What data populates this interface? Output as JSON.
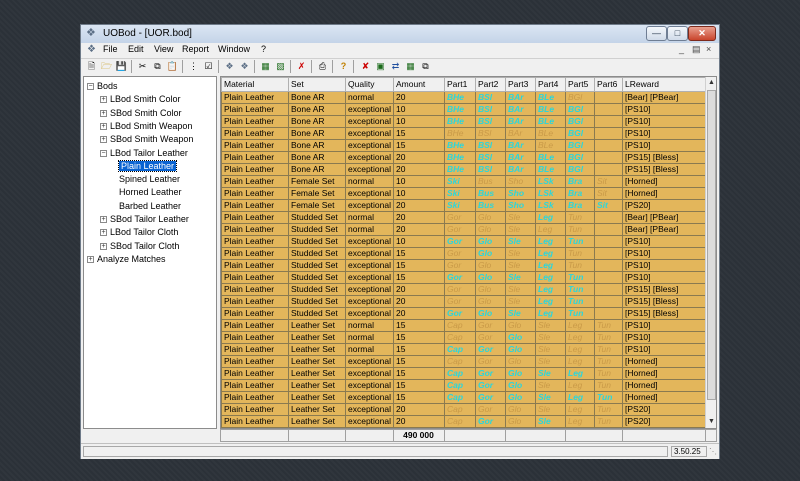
{
  "window": {
    "title": "UOBod - [UOR.bod]"
  },
  "menu": [
    "File",
    "Edit",
    "View",
    "Report",
    "Window",
    "?"
  ],
  "mdi": {
    "min": "_",
    "restore": "&#9635;",
    "close": "×"
  },
  "tree": [
    {
      "label": "Bods",
      "box": "−",
      "indent": 0
    },
    {
      "label": "LBod Smith Color",
      "box": "+",
      "indent": 1
    },
    {
      "label": "SBod Smith Color",
      "box": "+",
      "indent": 1
    },
    {
      "label": "LBod Smith Weapon",
      "box": "+",
      "indent": 1
    },
    {
      "label": "SBod Smith Weapon",
      "box": "+",
      "indent": 1
    },
    {
      "label": "LBod Tailor Leather",
      "box": "−",
      "indent": 1
    },
    {
      "label": "Plain Leather",
      "box": "",
      "indent": 2,
      "selected": true
    },
    {
      "label": "Spined Leather",
      "box": "",
      "indent": 2
    },
    {
      "label": "Horned Leather",
      "box": "",
      "indent": 2
    },
    {
      "label": "Barbed Leather",
      "box": "",
      "indent": 2
    },
    {
      "label": "SBod Tailor Leather",
      "box": "+",
      "indent": 1
    },
    {
      "label": "LBod Tailor Cloth",
      "box": "+",
      "indent": 1
    },
    {
      "label": "SBod Tailor Cloth",
      "box": "+",
      "indent": 1
    },
    {
      "label": "Analyze Matches",
      "box": "+",
      "indent": 0
    }
  ],
  "grid": {
    "columns": [
      "Material",
      "Set",
      "Quality",
      "Amount",
      "Part1",
      "Part2",
      "Part3",
      "Part4",
      "Part5",
      "Part6",
      "LReward"
    ],
    "rows": [
      [
        "Plain Leather",
        "Bone AR",
        "normal",
        "20",
        "BHe",
        "BSl",
        "BAr",
        "BLe",
        "BGl",
        "",
        "[Bear] [PBear]"
      ],
      [
        "Plain Leather",
        "Bone AR",
        "exceptional",
        "10",
        "BHe",
        "BSl",
        "BAr",
        "BLe",
        "BGl",
        "",
        "[PS10]"
      ],
      [
        "Plain Leather",
        "Bone AR",
        "exceptional",
        "10",
        "BHe",
        "BSl",
        "BAr",
        "BLe",
        "BGl",
        "",
        "[PS10]"
      ],
      [
        "Plain Leather",
        "Bone AR",
        "exceptional",
        "15",
        "BHe",
        "BSl",
        "BAr",
        "BLe",
        "BGl",
        "",
        "[PS10]"
      ],
      [
        "Plain Leather",
        "Bone AR",
        "exceptional",
        "15",
        "BHe",
        "BSl",
        "BAr",
        "BLe",
        "BGl",
        "",
        "[PS10]"
      ],
      [
        "Plain Leather",
        "Bone AR",
        "exceptional",
        "20",
        "BHe",
        "BSl",
        "BAr",
        "BLe",
        "BGl",
        "",
        "[PS15] [Bless]"
      ],
      [
        "Plain Leather",
        "Bone AR",
        "exceptional",
        "20",
        "BHe",
        "BSl",
        "BAr",
        "BLe",
        "BGl",
        "",
        "[PS15] [Bless]"
      ],
      [
        "Plain Leather",
        "Female Set",
        "normal",
        "10",
        "Ski",
        "Bus",
        "Sho",
        "LSk",
        "Bra",
        "Sit",
        "[Horned]"
      ],
      [
        "Plain Leather",
        "Female Set",
        "exceptional",
        "10",
        "Ski",
        "Bus",
        "Sho",
        "LSk",
        "Bra",
        "Sit",
        "[Horned]"
      ],
      [
        "Plain Leather",
        "Female Set",
        "exceptional",
        "20",
        "Ski",
        "Bus",
        "Sho",
        "LSk",
        "Bra",
        "Sit",
        "[PS20]"
      ],
      [
        "Plain Leather",
        "Studded Set",
        "normal",
        "20",
        "Gor",
        "Glo",
        "Sle",
        "Leg",
        "Tun",
        "",
        "[Bear] [PBear]"
      ],
      [
        "Plain Leather",
        "Studded Set",
        "normal",
        "20",
        "Gor",
        "Glo",
        "Sle",
        "Leg",
        "Tun",
        "",
        "[Bear] [PBear]"
      ],
      [
        "Plain Leather",
        "Studded Set",
        "exceptional",
        "10",
        "Gor",
        "Glo",
        "Sle",
        "Leg",
        "Tun",
        "",
        "[PS10]"
      ],
      [
        "Plain Leather",
        "Studded Set",
        "exceptional",
        "15",
        "Gor",
        "Glo",
        "Sle",
        "Leg",
        "Tun",
        "",
        "[PS10]"
      ],
      [
        "Plain Leather",
        "Studded Set",
        "exceptional",
        "15",
        "Gor",
        "Glo",
        "Sle",
        "Leg",
        "Tun",
        "",
        "[PS10]"
      ],
      [
        "Plain Leather",
        "Studded Set",
        "exceptional",
        "15",
        "Gor",
        "Glo",
        "Sle",
        "Leg",
        "Tun",
        "",
        "[PS10]"
      ],
      [
        "Plain Leather",
        "Studded Set",
        "exceptional",
        "20",
        "Gor",
        "Glo",
        "Sle",
        "Leg",
        "Tun",
        "",
        "[PS15] [Bless]"
      ],
      [
        "Plain Leather",
        "Studded Set",
        "exceptional",
        "20",
        "Gor",
        "Glo",
        "Sle",
        "Leg",
        "Tun",
        "",
        "[PS15] [Bless]"
      ],
      [
        "Plain Leather",
        "Studded Set",
        "exceptional",
        "20",
        "Gor",
        "Glo",
        "Sle",
        "Leg",
        "Tun",
        "",
        "[PS15] [Bless]"
      ],
      [
        "Plain Leather",
        "Leather Set",
        "normal",
        "15",
        "Cap",
        "Gor",
        "Glo",
        "Sle",
        "Leg",
        "Tun",
        "[PS10]"
      ],
      [
        "Plain Leather",
        "Leather Set",
        "normal",
        "15",
        "Cap",
        "Gor",
        "Glo",
        "Sle",
        "Leg",
        "Tun",
        "[PS10]"
      ],
      [
        "Plain Leather",
        "Leather Set",
        "normal",
        "15",
        "Cap",
        "Gor",
        "Glo",
        "Sle",
        "Leg",
        "Tun",
        "[PS10]"
      ],
      [
        "Plain Leather",
        "Leather Set",
        "exceptional",
        "15",
        "Cap",
        "Gor",
        "Glo",
        "Sle",
        "Leg",
        "Tun",
        "[Horned]"
      ],
      [
        "Plain Leather",
        "Leather Set",
        "exceptional",
        "15",
        "Cap",
        "Gor",
        "Glo",
        "Sle",
        "Leg",
        "Tun",
        "[Horned]"
      ],
      [
        "Plain Leather",
        "Leather Set",
        "exceptional",
        "15",
        "Cap",
        "Gor",
        "Glo",
        "Sle",
        "Leg",
        "Tun",
        "[Horned]"
      ],
      [
        "Plain Leather",
        "Leather Set",
        "exceptional",
        "15",
        "Cap",
        "Gor",
        "Glo",
        "Sle",
        "Leg",
        "Tun",
        "[Horned]"
      ],
      [
        "Plain Leather",
        "Leather Set",
        "exceptional",
        "20",
        "Cap",
        "Gor",
        "Glo",
        "Sle",
        "Leg",
        "Tun",
        "[PS20]"
      ],
      [
        "Plain Leather",
        "Leather Set",
        "exceptional",
        "20",
        "Cap",
        "Gor",
        "Glo",
        "Sle",
        "Leg",
        "Tun",
        "[PS20]"
      ]
    ],
    "have": [
      [
        1,
        1,
        1,
        1,
        0,
        0
      ],
      [
        1,
        1,
        1,
        1,
        1,
        0
      ],
      [
        1,
        1,
        1,
        1,
        1,
        0
      ],
      [
        0,
        0,
        0,
        0,
        1,
        0
      ],
      [
        1,
        1,
        1,
        0,
        1,
        0
      ],
      [
        1,
        1,
        1,
        1,
        1,
        0
      ],
      [
        1,
        1,
        1,
        1,
        1,
        0
      ],
      [
        1,
        0,
        0,
        1,
        1,
        0
      ],
      [
        1,
        1,
        1,
        1,
        1,
        0
      ],
      [
        1,
        1,
        1,
        1,
        1,
        1
      ],
      [
        0,
        0,
        0,
        1,
        0,
        0
      ],
      [
        0,
        0,
        0,
        0,
        0,
        0
      ],
      [
        1,
        1,
        1,
        1,
        1,
        0
      ],
      [
        0,
        1,
        0,
        1,
        0,
        0
      ],
      [
        0,
        0,
        0,
        1,
        0,
        0
      ],
      [
        1,
        1,
        1,
        1,
        1,
        0
      ],
      [
        0,
        0,
        0,
        1,
        1,
        0
      ],
      [
        0,
        0,
        0,
        1,
        1,
        0
      ],
      [
        1,
        1,
        1,
        1,
        1,
        0
      ],
      [
        0,
        0,
        0,
        0,
        0,
        0
      ],
      [
        0,
        0,
        1,
        0,
        0,
        0
      ],
      [
        1,
        1,
        1,
        0,
        0,
        0
      ],
      [
        0,
        0,
        0,
        0,
        0,
        0
      ],
      [
        1,
        1,
        1,
        1,
        1,
        0
      ],
      [
        1,
        1,
        1,
        0,
        0,
        0
      ],
      [
        1,
        1,
        1,
        1,
        1,
        1
      ],
      [
        0,
        0,
        0,
        0,
        0,
        0
      ],
      [
        0,
        1,
        0,
        1,
        0,
        0
      ]
    ]
  },
  "footer": {
    "total": "490 000"
  },
  "status": {
    "version": "3.50.25"
  }
}
